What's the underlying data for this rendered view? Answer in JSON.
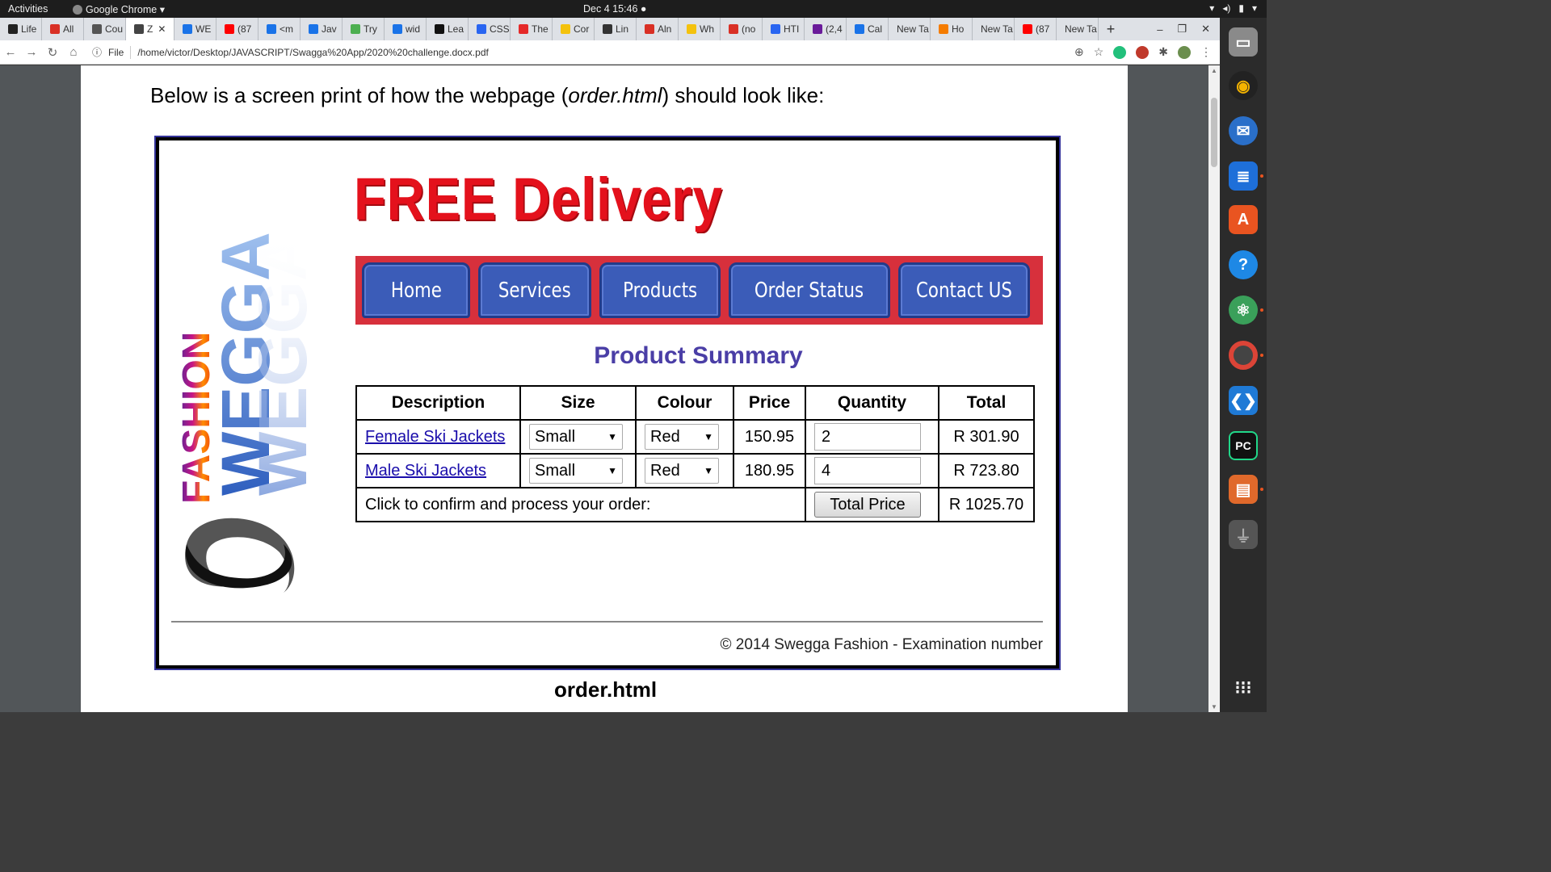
{
  "topbar": {
    "activities": "Activities",
    "app_name": "Google Chrome ▾",
    "clock": "Dec 4  15:46  ●"
  },
  "tabs": [
    {
      "label": "Life",
      "color": "#222222"
    },
    {
      "label": "All",
      "color": "#d93025"
    },
    {
      "label": "Cou",
      "color": "#555555"
    },
    {
      "label": "Z",
      "color": "#444444",
      "active": true
    },
    {
      "label": "WE",
      "color": "#1a73e8"
    },
    {
      "label": "(87",
      "color": "#ff0000"
    },
    {
      "label": "<m",
      "color": "#1a73e8"
    },
    {
      "label": "Jav",
      "color": "#1a73e8"
    },
    {
      "label": "Try",
      "color": "#4caf50"
    },
    {
      "label": "wid",
      "color": "#1a73e8"
    },
    {
      "label": "Lea",
      "color": "#111111"
    },
    {
      "label": "CSS",
      "color": "#2965f1"
    },
    {
      "label": "The",
      "color": "#e52929"
    },
    {
      "label": "Cor",
      "color": "#f4c20d"
    },
    {
      "label": "Lin",
      "color": "#333333"
    },
    {
      "label": "Aln",
      "color": "#d93025"
    },
    {
      "label": "Wh",
      "color": "#f4c20d"
    },
    {
      "label": "(no",
      "color": "#d93025"
    },
    {
      "label": "HTI",
      "color": "#2965f1"
    },
    {
      "label": "(2,4",
      "color": "#6a1b9a"
    },
    {
      "label": "Cal",
      "color": "#1a73e8"
    },
    {
      "label": "New Ta",
      "color": ""
    },
    {
      "label": "Ho",
      "color": "#f57c00"
    },
    {
      "label": "New Ta",
      "color": ""
    },
    {
      "label": "(87",
      "color": "#ff0000"
    },
    {
      "label": "New Ta",
      "color": ""
    }
  ],
  "address": {
    "scheme": "File",
    "url": "/home/victor/Desktop/JAVASCRIPT/Swagga%20App/2020%20challenge.docx.pdf"
  },
  "doc": {
    "intro_before": "Below is a screen print of how the webpage (",
    "intro_file": "order.html",
    "intro_after": ") should look like:",
    "caption": "order.html"
  },
  "shot": {
    "logo": {
      "word1": "FASHION",
      "word2": "SWEGGA",
      "ghost": "WEGGA"
    },
    "banner": "FREE Delivery",
    "nav": [
      "Home",
      "Services",
      "Products",
      "Order Status",
      "Contact US"
    ],
    "summary_title": "Product Summary",
    "table": {
      "headers": [
        "Description",
        "Size",
        "Colour",
        "Price",
        "Quantity",
        "Total"
      ],
      "rows": [
        {
          "description": "Female Ski Jackets",
          "size": "Small",
          "colour": "Red",
          "price": "150.95",
          "quantity": "2",
          "total": "R 301.90"
        },
        {
          "description": "Male Ski Jackets",
          "size": "Small",
          "colour": "Red",
          "price": "180.95",
          "quantity": "4",
          "total": "R 723.80"
        }
      ],
      "confirm_text": "Click to confirm and process your order:",
      "total_button": "Total Price",
      "grand_total": "R 1025.70"
    },
    "footer": "© 2014 Swegga Fashion - Examination number"
  },
  "colors": {
    "banner_red": "#e4111c",
    "nav_bg": "#d7303c",
    "nav_button": "#3b5cb8",
    "summary_purple": "#4a3ea6",
    "link": "#1a0dab"
  }
}
